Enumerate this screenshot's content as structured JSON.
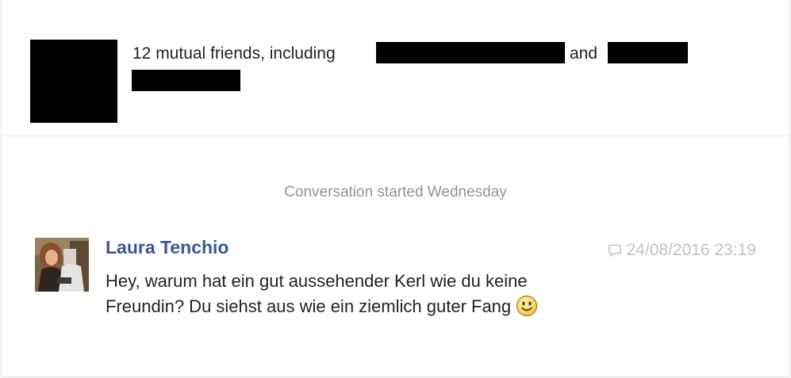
{
  "mutual_friends": {
    "lead_text": "12 mutual friends, including",
    "and_text": "and"
  },
  "conversation": {
    "started_label": "Conversation started Wednesday"
  },
  "message": {
    "sender": "Laura Tenchio",
    "timestamp": "24/08/2016 23:19",
    "line1": "Hey, warum hat ein gut aussehender Kerl wie du keine",
    "line2": "Freundin? Du siehst aus wie ein ziemlich guter Fang",
    "emoji": "smiley-face-icon"
  },
  "colors": {
    "sender_link": "#365899",
    "meta_gray": "#90949c",
    "timestamp_gray": "#bec2c9",
    "text": "#1d2129",
    "border": "#dddfe2"
  }
}
